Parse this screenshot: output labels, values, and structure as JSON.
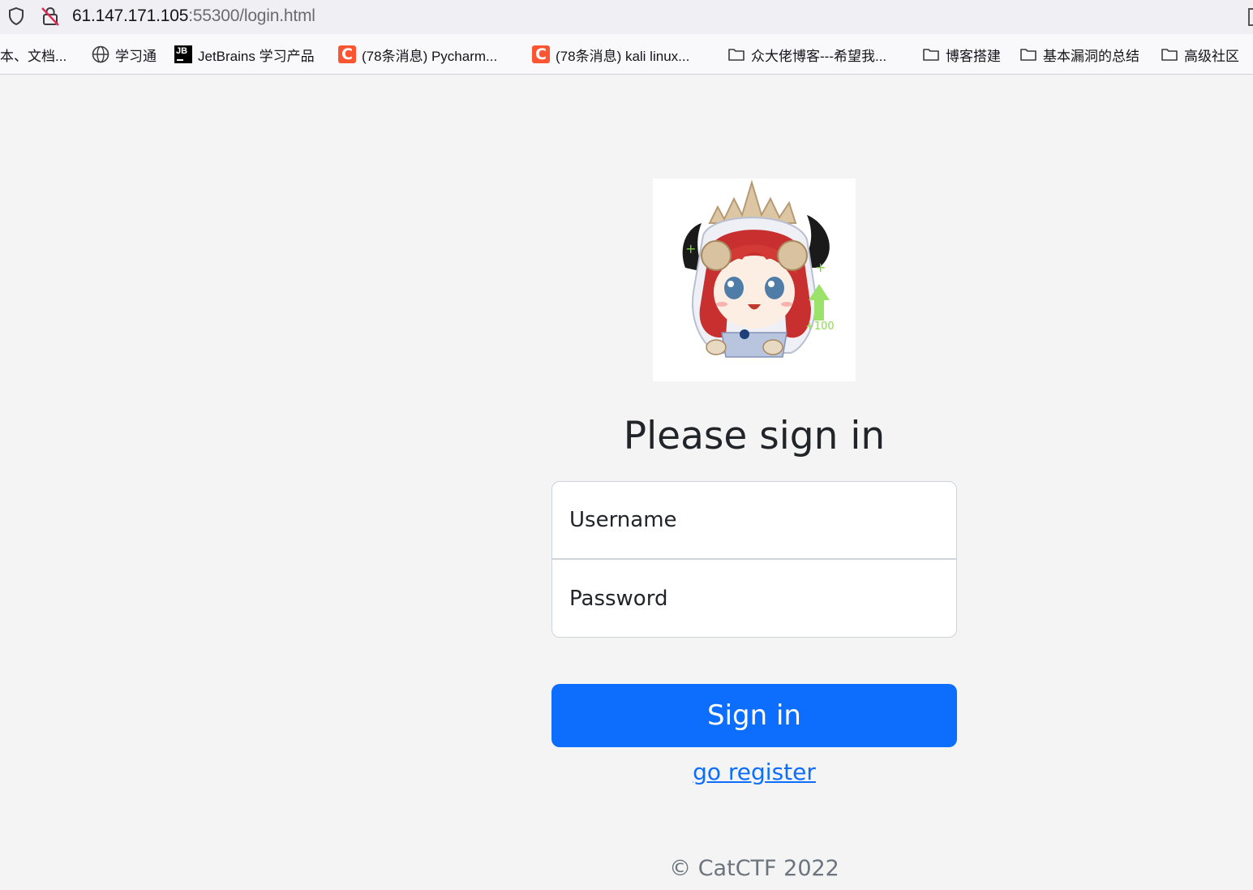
{
  "browser": {
    "url_host": "61.147.171.105",
    "url_rest": ":55300/login.html"
  },
  "bookmarks": [
    {
      "label": "本、文档...",
      "icon": "none"
    },
    {
      "label": "学习通",
      "icon": "globe-icon"
    },
    {
      "label": "JetBrains 学习产品",
      "icon": "jetbrains-icon"
    },
    {
      "label": "(78条消息) Pycharm...",
      "icon": "csdn-icon"
    },
    {
      "label": "(78条消息) kali linux...",
      "icon": "csdn-icon"
    },
    {
      "label": "众大佬博客---希望我...",
      "icon": "folder-icon"
    },
    {
      "label": "博客搭建",
      "icon": "folder-icon"
    },
    {
      "label": "基本漏洞的总结",
      "icon": "folder-icon"
    },
    {
      "label": "高级社区",
      "icon": "folder-icon"
    }
  ],
  "login": {
    "heading": "Please sign in",
    "username_placeholder": "Username",
    "password_placeholder": "Password",
    "submit_label": "Sign in",
    "register_link": "go register",
    "copyright": "© CatCTF 2022",
    "avatar_badge": "+100"
  },
  "colors": {
    "primary": "#0d6efd",
    "page_bg": "#f4f4f5"
  }
}
